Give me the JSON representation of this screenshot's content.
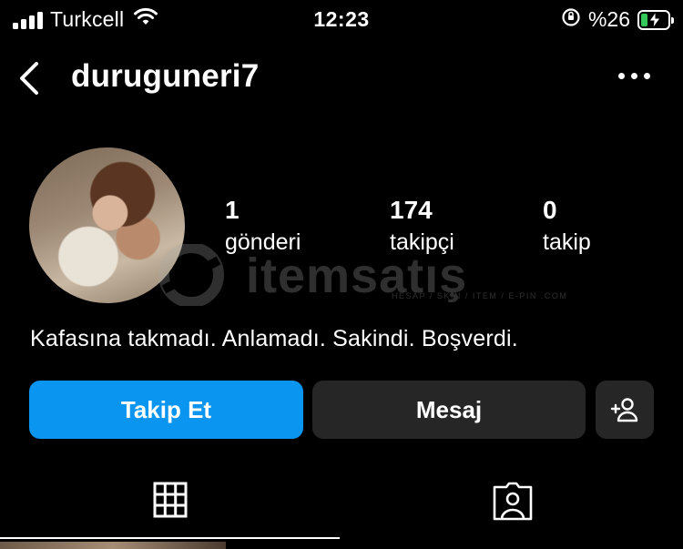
{
  "status_bar": {
    "carrier": "Turkcell",
    "time": "12:23",
    "battery_percent": "%26",
    "battery_level": 0.26,
    "battery_color": "#35c759",
    "icons": [
      "signal-icon",
      "wifi-icon",
      "orientation-lock-icon",
      "battery-charging-icon"
    ]
  },
  "header": {
    "username": "duruguneri7",
    "back_icon": "chevron-left-icon",
    "more_icon": "more-horizontal-icon"
  },
  "profile": {
    "stats": [
      {
        "value": "1",
        "label": "gönderi"
      },
      {
        "value": "174",
        "label": "takipçi"
      },
      {
        "value": "0",
        "label": "takip"
      }
    ],
    "bio": "Kafasına takmadı. Anlamadı. Sakindi. Boşverdi."
  },
  "watermark": {
    "text": "itemsatış",
    "subtext": "HESAP / SKIN / ITEM / E-PIN .COM"
  },
  "actions": {
    "follow_label": "Takip Et",
    "message_label": "Mesaj",
    "follow_color": "#0a95f0",
    "secondary_color": "#262626",
    "add_icon": "add-person-icon"
  },
  "tabs": {
    "items": [
      {
        "icon": "grid-icon",
        "active": true
      },
      {
        "icon": "tagged-person-icon",
        "active": false
      }
    ]
  }
}
